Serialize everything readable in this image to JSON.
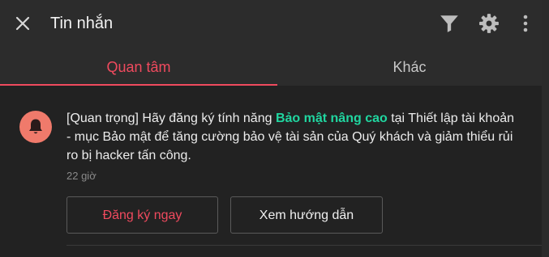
{
  "header": {
    "title": "Tin nhắn",
    "icons": [
      "close-icon",
      "filter-icon",
      "gear-icon",
      "more-vertical-icon"
    ]
  },
  "tabs": [
    {
      "label": "Quan tâm",
      "active": true
    },
    {
      "label": "Khác",
      "active": false
    }
  ],
  "notification": {
    "icon": "bell-icon",
    "message_prefix": "[Quan trọng] Hãy đăng ký tính năng ",
    "message_highlight": "Bảo mật nâng cao",
    "message_suffix": " tại Thiết lập tài khoản - mục Bảo mật để tăng cường bảo vệ tài sản của Quý khách và giảm thiểu rủi ro bị hacker tấn công.",
    "time": "22 giờ",
    "primary_button": "Đăng ký ngay",
    "secondary_button": "Xem hướng dẫn"
  },
  "colors": {
    "accent": "#f04a5e",
    "highlight": "#20d6a0",
    "avatar_bg": "#f07a6b",
    "header_bg": "#2c2c2c",
    "panel_bg": "#222222"
  }
}
